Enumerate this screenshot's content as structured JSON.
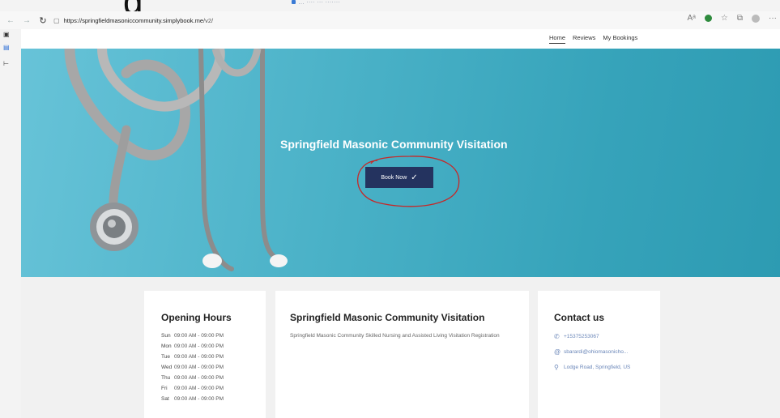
{
  "window": {
    "partial_title": "… ···· ··· ·······",
    "overlay_letter": "g"
  },
  "browser": {
    "url_host": "https://springfieldmasoniccommunity.simplybook.me",
    "url_path": "/v2/",
    "icons": [
      "back-icon",
      "forward-icon",
      "refresh-icon",
      "page-info-icon",
      "read-aloud-icon",
      "extension-icon",
      "favorites-icon",
      "collections-icon",
      "profile-icon",
      "more-icon"
    ]
  },
  "nav": {
    "links": [
      "Home",
      "Reviews",
      "My Bookings"
    ]
  },
  "hero": {
    "title": "Springfield Masonic Community Visitation",
    "book_label": "Book Now"
  },
  "hours": {
    "title": "Opening Hours",
    "rows": [
      {
        "day": "Sun",
        "time": "09:00 AM - 09:00 PM"
      },
      {
        "day": "Mon",
        "time": "09:00 AM - 09:00 PM"
      },
      {
        "day": "Tue",
        "time": "09:00 AM - 09:00 PM"
      },
      {
        "day": "Wed",
        "time": "09:00 AM - 09:00 PM"
      },
      {
        "day": "Thu",
        "time": "09:00 AM - 09:00 PM"
      },
      {
        "day": "Fri",
        "time": "09:00 AM - 09:00 PM"
      },
      {
        "day": "Sat",
        "time": "09:00 AM - 09:00 PM"
      }
    ]
  },
  "about": {
    "title": "Springfield Masonic Community Visitation",
    "description": "Springfield Masonic Community Skilled Nursing and Assisted Living Visitation Registration"
  },
  "contact": {
    "title": "Contact us",
    "phone": "+15375253067",
    "email": "sbarardi@ohiomasonicho...",
    "address": "Lodge Road, Springfield, US"
  },
  "colors": {
    "hero_bg": "#48b0c6",
    "button_bg": "#24335f",
    "annotation": "#c62828",
    "link": "#6a86b8"
  }
}
